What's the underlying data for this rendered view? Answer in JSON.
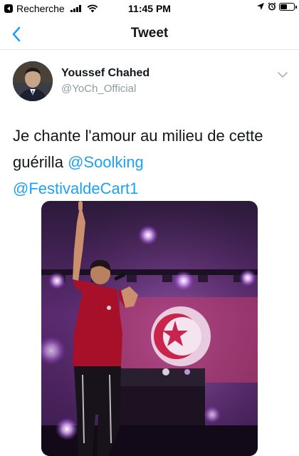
{
  "status_bar": {
    "back_app_label": "Recherche",
    "time": "11:45 PM"
  },
  "nav": {
    "title": "Tweet"
  },
  "tweet": {
    "author_name": "Youssef Chahed",
    "author_handle": "@YoCh_Official",
    "text": "Je chante l'amour au milieu de cette guérilla",
    "mentions": [
      "@Soolking",
      "@FestivaldeCart1"
    ],
    "media_description": "Performer on stage pointing up, Tunisian flag backdrop"
  },
  "colors": {
    "accent": "#1da1f2",
    "text_primary": "#14171a",
    "text_secondary": "#8f9ba5",
    "divider": "#e1e8ed",
    "flag_red": "#e70013"
  }
}
